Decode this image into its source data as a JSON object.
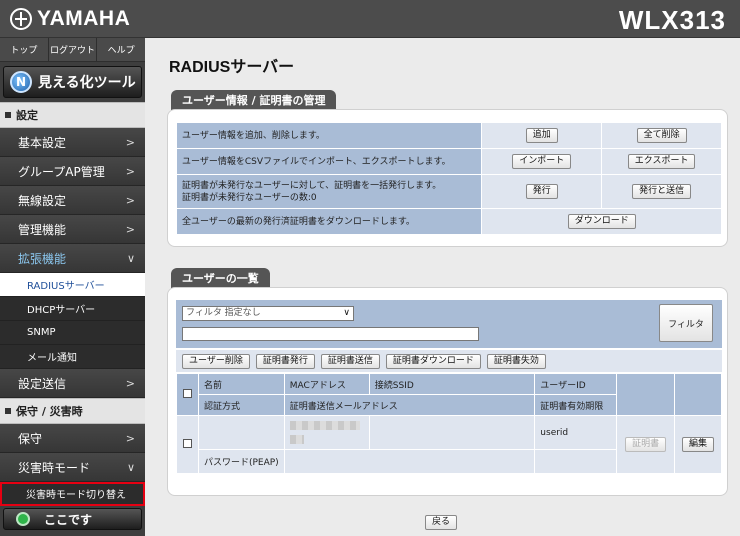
{
  "header": {
    "brand": "YAMAHA",
    "model": "WLX313"
  },
  "topnav": [
    "トップ",
    "ログアウト",
    "ヘルプ"
  ],
  "visual_tool": {
    "label": "見える化ツール",
    "icon": "visualization-gauge-icon"
  },
  "sidebar": {
    "settings_header": "設定",
    "items": [
      {
        "label": "基本設定"
      },
      {
        "label": "グループAP管理"
      },
      {
        "label": "無線設定"
      },
      {
        "label": "管理機能"
      },
      {
        "label": "拡張機能"
      }
    ],
    "sub_items": [
      {
        "label": "RADIUSサーバー"
      },
      {
        "label": "DHCPサーバー"
      },
      {
        "label": "SNMP"
      },
      {
        "label": "メール通知"
      }
    ],
    "transfer": {
      "label": "設定送信"
    },
    "maintenance_header": "保守 / 災害時",
    "maintenance_items": [
      {
        "label": "保守"
      },
      {
        "label": "災害時モード"
      }
    ],
    "disaster_switch": "災害時モード切り替え",
    "here_button": "ここです"
  },
  "main": {
    "title": "RADIUSサーバー",
    "mgmt_panel": {
      "tab": "ユーザー情報 / 証明書の管理",
      "rows": [
        {
          "desc": "ユーザー情報を追加、削除します。",
          "btn1": "追加",
          "btn2": "全て削除"
        },
        {
          "desc": "ユーザー情報をCSVファイルでインポート、エクスポートします。",
          "btn1": "インポート",
          "btn2": "エクスポート"
        },
        {
          "desc1": "証明書が未発行なユーザーに対して、証明書を一括発行します。",
          "desc2": "証明書が未発行なユーザーの数:0",
          "btn1": "発行",
          "btn2": "発行と送信"
        },
        {
          "desc": "全ユーザーの最新の発行済証明書をダウンロードします。",
          "btn": "ダウンロード"
        }
      ]
    },
    "users_panel": {
      "tab": "ユーザーの一覧",
      "filter_select": "フィルタ 指定なし",
      "filter_button": "フィルタ",
      "toolbar": [
        "ユーザー削除",
        "証明書発行",
        "証明書送信",
        "証明書ダウンロード",
        "証明書失効"
      ],
      "headers": {
        "name": "名前",
        "mac": "MACアドレス",
        "ssid": "接続SSID",
        "userid": "ユーザーID",
        "auth": "認証方式",
        "mail": "証明書送信メールアドレス",
        "expiry": "証明書有効期限"
      },
      "row": {
        "userid": "userid",
        "auth": "パスワード(PEAP)",
        "cert_button": "証明書",
        "edit_button": "編集"
      }
    },
    "back_button": "戻る"
  }
}
